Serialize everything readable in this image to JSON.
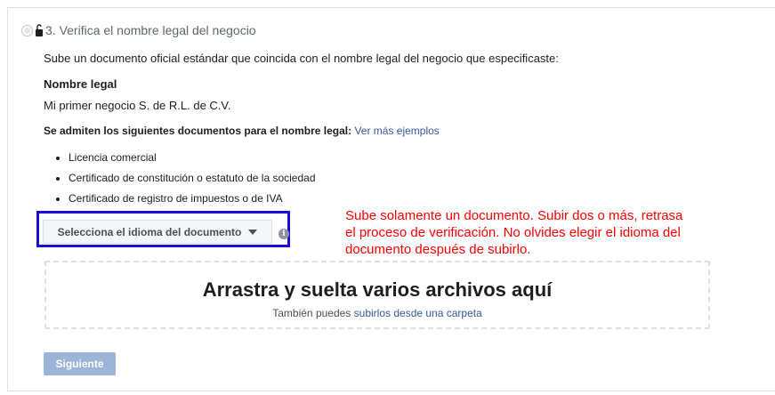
{
  "step": {
    "title": "3. Verifica el nombre legal del negocio",
    "description": "Sube un documento oficial estándar que coincida con el nombre legal del negocio que especificaste:"
  },
  "legal_name": {
    "label": "Nombre legal",
    "value": "Mi primer negocio S. de R.L. de C.V."
  },
  "documents": {
    "heading": "Se admiten los siguientes documentos para el nombre legal:",
    "more_examples_link": "Ver más ejemplos",
    "items": [
      "Licencia comercial",
      "Certificado de constitución o estatuto de la sociedad",
      "Certificado de registro de impuestos o de IVA"
    ]
  },
  "language_select": {
    "label": "Selecciona el idioma del documento"
  },
  "annotation": {
    "text": "Sube solamente un documento. Subir dos o más, retrasa el proceso de verificación. No olvides elegir el idioma del documento después de subirlo."
  },
  "dropzone": {
    "title": "Arrastra y suelta varios archivos aquí",
    "subtitle_prefix": "También puedes ",
    "subtitle_link": "subirlos desde una carpeta"
  },
  "next_button": {
    "label": "Siguiente"
  },
  "colors": {
    "highlight_border": "#1a0fd8",
    "annotation_text": "#ff0000",
    "link": "#385898",
    "next_button_disabled": "#9cb4d8"
  },
  "icons": {
    "step_radio": "radio-icon",
    "lock": "lock-icon",
    "dropdown_caret": "caret-down-icon",
    "info": "info-icon"
  }
}
